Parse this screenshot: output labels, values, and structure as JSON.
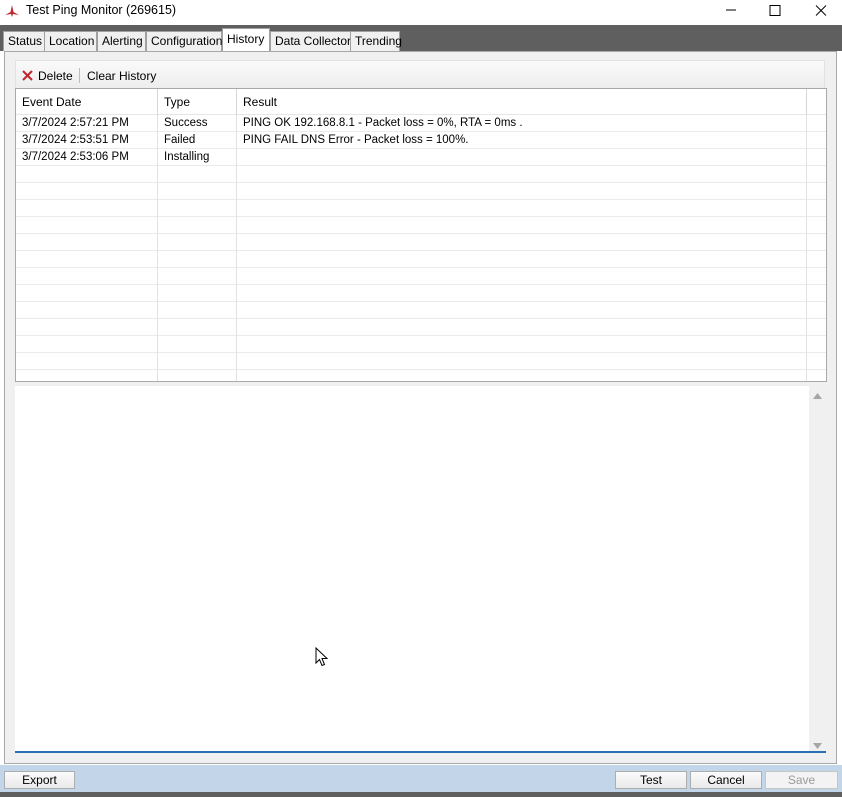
{
  "window": {
    "title": "Test Ping Monitor (269615)",
    "app_icon": "trident-logo-icon",
    "controls": [
      "minimize-icon",
      "maximize-icon",
      "close-icon"
    ]
  },
  "tabs": [
    {
      "label": "Status",
      "active": false
    },
    {
      "label": "Location",
      "active": false
    },
    {
      "label": "Alerting",
      "active": false
    },
    {
      "label": "Configuration",
      "active": false
    },
    {
      "label": "History",
      "active": true
    },
    {
      "label": "Data Collector",
      "active": false
    },
    {
      "label": "Trending",
      "active": false
    }
  ],
  "toolbar": {
    "delete_label": "Delete",
    "delete_icon": "red-x-icon",
    "clear_label": "Clear History"
  },
  "grid": {
    "columns": [
      "Event Date",
      "Type",
      "Result"
    ],
    "rows": [
      {
        "date": "3/7/2024 2:57:21 PM",
        "type": "Success",
        "result": "PING OK 192.168.8.1 - Packet loss = 0%, RTA = 0ms ."
      },
      {
        "date": "3/7/2024 2:53:51 PM",
        "type": "Failed",
        "result": "PING FAIL DNS Error - Packet loss = 100%."
      },
      {
        "date": "3/7/2024 2:53:06 PM",
        "type": "Installing",
        "result": ""
      }
    ],
    "empty_rows": 13
  },
  "detail": {
    "text": ""
  },
  "buttons": {
    "export": "Export",
    "test": "Test",
    "cancel": "Cancel",
    "save": "Save"
  },
  "colors": {
    "tabstrip_bg": "#5f5f5f",
    "bottom_bar": "#c3d5e8",
    "focus_underline": "#2b6fb5",
    "delete_icon": "#c0282d"
  }
}
